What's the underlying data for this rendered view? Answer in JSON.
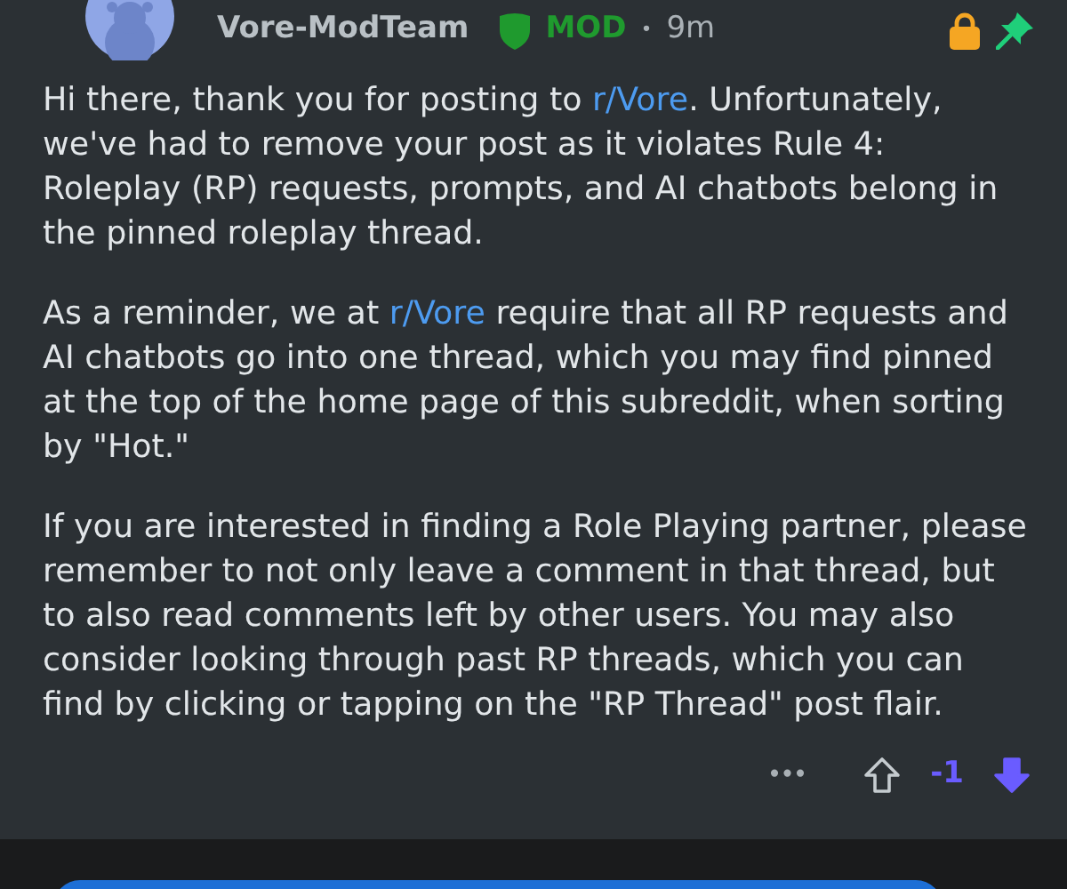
{
  "comment": {
    "author": "Vore-ModTeam",
    "mod_label": "MOD",
    "separator": "•",
    "time": "9m",
    "locked": true,
    "pinned": true,
    "paragraphs": [
      {
        "parts": [
          {
            "text": "Hi there, thank you for posting to "
          },
          {
            "text": "r/Vore",
            "kind": "link"
          },
          {
            "text": ". Unfortunately, we've had to remove your post as it violates Rule 4: Roleplay (RP) requests, prompts, and AI chatbots belong in the pinned roleplay thread."
          }
        ]
      },
      {
        "parts": [
          {
            "text": "As a reminder, we at "
          },
          {
            "text": "r/Vore",
            "kind": "link"
          },
          {
            "text": " require that all RP requests and AI chatbots go into one thread, which you may find pinned at the top of the home page of this subreddit, when sorting by \"Hot.\""
          }
        ]
      },
      {
        "parts": [
          {
            "text": "If you are interested in finding a Role Playing partner, please remember to not only leave a comment in that thread, but to also read comments left by other users. You may also consider looking through past RP threads, which you can find by clicking or tapping on the \"RP Thread\" post flair."
          }
        ]
      }
    ],
    "more": "•••",
    "score": "-1",
    "upvoted": false,
    "downvoted": true
  }
}
